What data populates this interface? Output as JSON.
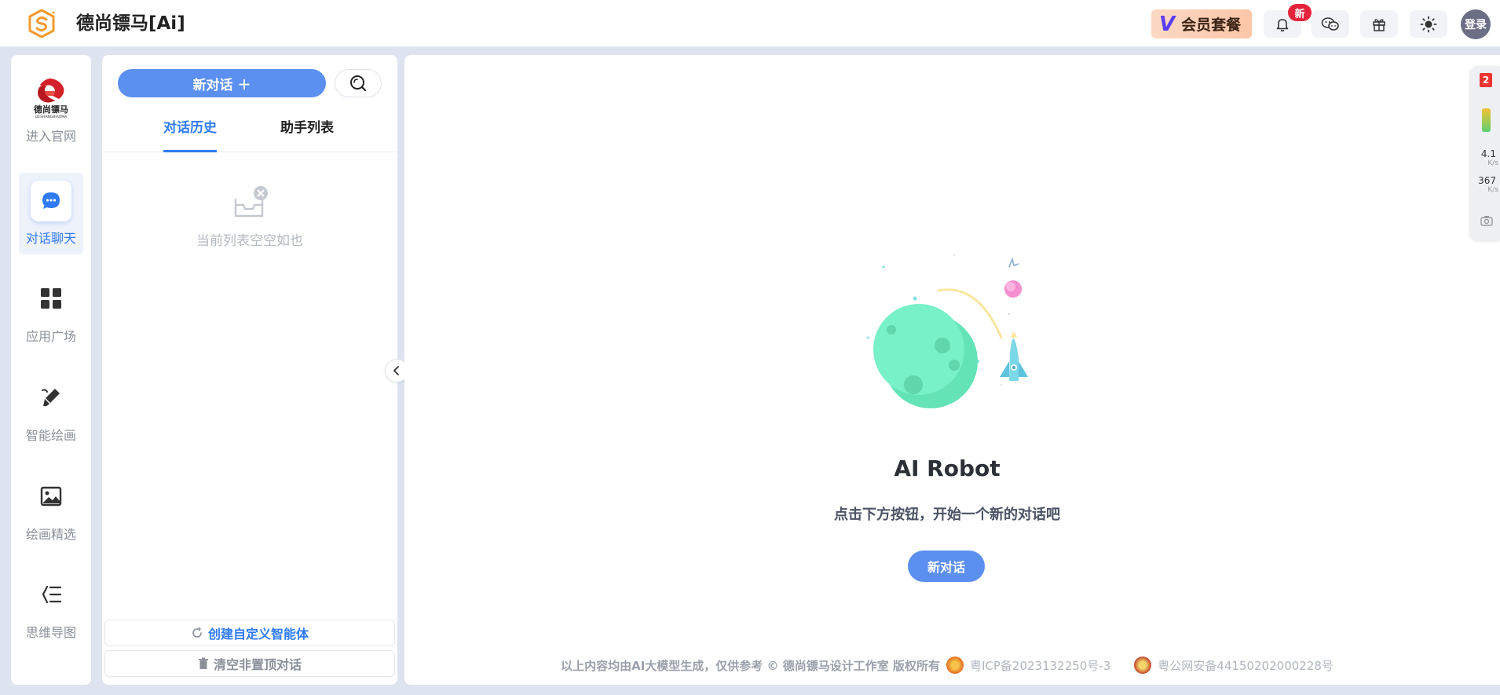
{
  "header": {
    "app_title": "德尚镖马[Ai]",
    "vip_label": "会员套餐",
    "notification_badge": "新",
    "login_label": "登录"
  },
  "nav": {
    "items": [
      {
        "label": "进入官网",
        "icon": "brand-logo"
      },
      {
        "label": "对话聊天",
        "icon": "chat-icon",
        "active": true
      },
      {
        "label": "应用广场",
        "icon": "grid-icon"
      },
      {
        "label": "智能绘画",
        "icon": "paint-brush-icon"
      },
      {
        "label": "绘画精选",
        "icon": "image-icon"
      },
      {
        "label": "思维导图",
        "icon": "mindmap-icon"
      }
    ],
    "brand_text": "德尚镖马",
    "brand_subtext": "DESHANGBIAOMA"
  },
  "sidebar": {
    "new_chat_label": "新对话 ＋",
    "tabs": [
      "对话历史",
      "助手列表"
    ],
    "empty_text": "当前列表空空如也",
    "create_agent_label": "创建自定义智能体",
    "clear_label": "清空非置顶对话"
  },
  "main": {
    "title": "AI Robot",
    "subtitle": "点击下方按钮，开始一个新的对话吧",
    "new_chat_button": "新对话"
  },
  "footer": {
    "disclaimer": "以上内容均由AI大模型生成，仅供参考 © 德尚镖马设计工作室  版权所有",
    "icp": "粤ICP备2023132250号-3",
    "police": "粤公网安备44150202000228号"
  },
  "monitor": {
    "badge": "2",
    "upload_value": "4.1",
    "download_value": "367",
    "unit": "K/s"
  },
  "colors": {
    "accent": "#5b8ff0",
    "active_text": "#2f7bf5",
    "badge_red": "#e5243b"
  }
}
